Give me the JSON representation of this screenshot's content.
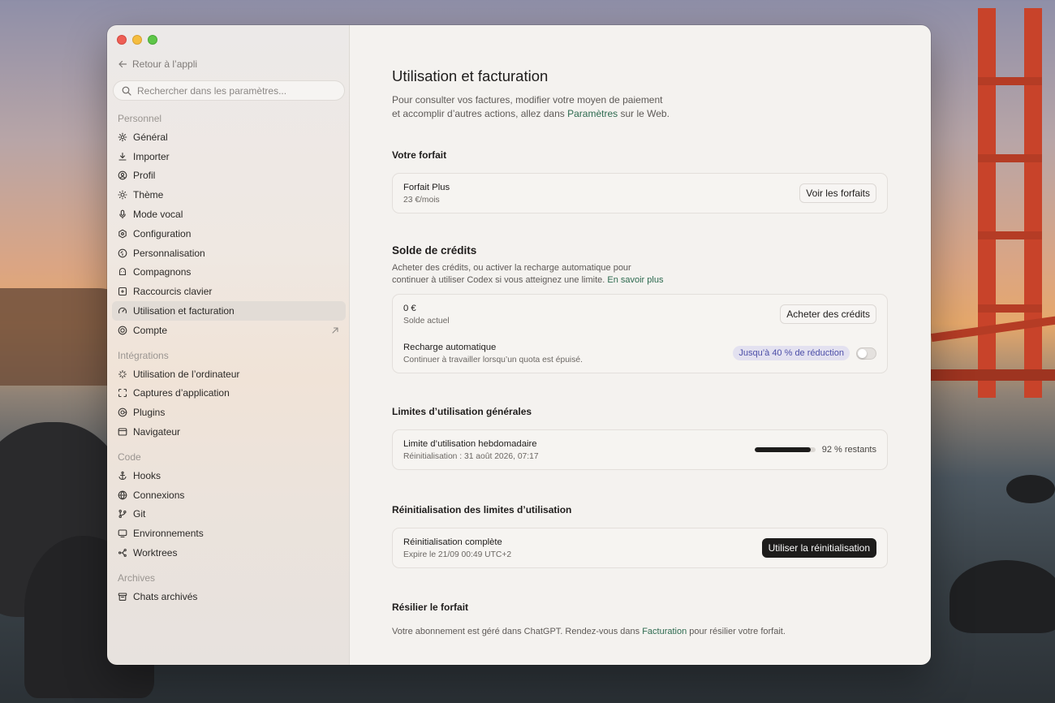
{
  "window": {
    "traffic_lights": {
      "red": "#ee5e55",
      "yellow": "#f5bd3f",
      "green": "#5ec648"
    }
  },
  "sidebar": {
    "back_label": "Retour à l’appli",
    "search_placeholder": "Rechercher dans les paramètres...",
    "sections": [
      {
        "title": "Personnel",
        "items": [
          {
            "label": "Général",
            "icon": "gear-icon"
          },
          {
            "label": "Importer",
            "icon": "download-icon"
          },
          {
            "label": "Profil",
            "icon": "user-circle-icon"
          },
          {
            "label": "Thème",
            "icon": "sun-icon"
          },
          {
            "label": "Mode vocal",
            "icon": "microphone-icon"
          },
          {
            "label": "Configuration",
            "icon": "config-icon"
          },
          {
            "label": "Personnalisation",
            "icon": "personalization-icon"
          },
          {
            "label": "Compagnons",
            "icon": "companion-icon"
          },
          {
            "label": "Raccourcis clavier",
            "icon": "keyboard-icon"
          },
          {
            "label": "Utilisation et facturation",
            "icon": "gauge-icon",
            "active": true
          },
          {
            "label": "Compte",
            "icon": "account-icon",
            "external": true
          }
        ]
      },
      {
        "title": "Intégrations",
        "items": [
          {
            "label": "Utilisation de l’ordinateur",
            "icon": "sparkle-icon"
          },
          {
            "label": "Captures d’application",
            "icon": "capture-icon"
          },
          {
            "label": "Plugins",
            "icon": "plugin-icon"
          },
          {
            "label": "Navigateur",
            "icon": "browser-icon"
          }
        ]
      },
      {
        "title": "Code",
        "items": [
          {
            "label": "Hooks",
            "icon": "anchor-icon"
          },
          {
            "label": "Connexions",
            "icon": "globe-icon"
          },
          {
            "label": "Git",
            "icon": "git-branch-icon"
          },
          {
            "label": "Environnements",
            "icon": "monitor-icon"
          },
          {
            "label": "Worktrees",
            "icon": "worktree-icon"
          }
        ]
      },
      {
        "title": "Archives",
        "items": [
          {
            "label": "Chats archivés",
            "icon": "archive-icon"
          }
        ]
      }
    ]
  },
  "main": {
    "title": "Utilisation et facturation",
    "desc_line1": "Pour consulter vos factures, modifier votre moyen de paiement",
    "desc_line2_pre": "et accomplir d’autres actions, allez dans ",
    "desc_link": "Paramètres",
    "desc_line2_post": " sur le Web.",
    "plan": {
      "heading": "Votre forfait",
      "name": "Forfait Plus",
      "price": "23 €/mois",
      "button": "Voir les forfaits"
    },
    "credits": {
      "heading": "Solde de crédits",
      "desc_line1": "Acheter des crédits, ou activer la recharge automatique pour",
      "desc_line2_pre": "continuer à utiliser Codex si vous atteignez une limite. ",
      "desc_link": "En savoir plus",
      "balance_value": "0 €",
      "balance_label": "Solde actuel",
      "buy_button": "Acheter des crédits",
      "auto_title": "Recharge automatique",
      "auto_sub": "Continuer à travailler lorsqu’un quota est épuisé.",
      "auto_badge": "Jusqu’à 40 % de réduction",
      "auto_enabled": false
    },
    "limits": {
      "heading": "Limites d’utilisation générales",
      "weekly_title": "Limite d’utilisation hebdomadaire",
      "weekly_reset": "Réinitialisation : 31 août 2026, 07:17",
      "remaining_fraction": 0.92,
      "remaining_label": "92 % restants"
    },
    "reset": {
      "heading": "Réinitialisation des limites d’utilisation",
      "title": "Réinitialisation complète",
      "expires": "Expire le 21/09 00:49 UTC+2",
      "button": "Utiliser la réinitialisation"
    },
    "cancel": {
      "heading": "Résilier le forfait",
      "text_pre": "Votre abonnement est géré dans ChatGPT. Rendez-vous dans ",
      "link": "Facturation",
      "text_post": " pour résilier votre forfait."
    }
  }
}
